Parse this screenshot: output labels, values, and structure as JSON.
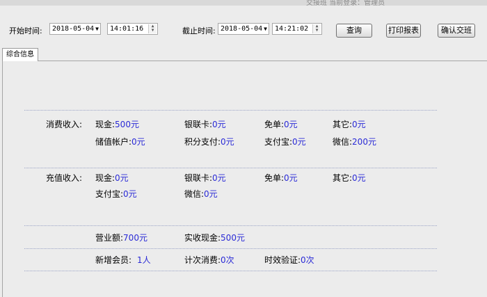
{
  "titlebar": {
    "text": "交接班   当前登录：管理员"
  },
  "toolbar": {
    "start_label": "开始时间:",
    "start_date": "2018-05-04",
    "start_time": "14:01:16",
    "end_label": "截止时间:",
    "end_date": "2018-05-04",
    "end_time": "14:21:02",
    "query_button": "查询",
    "print_button": "打印报表",
    "confirm_button": "确认交班"
  },
  "tab": {
    "label": "综合信息"
  },
  "consumption": {
    "label": "消费收入:",
    "cash_key": "现金:",
    "cash_val": "500元",
    "unionpay_key": "银联卡:",
    "unionpay_val": "0元",
    "free_key": "免单:",
    "free_val": "0元",
    "other_key": "其它:",
    "other_val": "0元",
    "stored_key": "储值帐户:",
    "stored_val": "0元",
    "points_key": "积分支付:",
    "points_val": "0元",
    "alipay_key": "支付宝:",
    "alipay_val": "0元",
    "wechat_key": "微信:",
    "wechat_val": "200元"
  },
  "recharge": {
    "label": "充值收入:",
    "cash_key": "现金:",
    "cash_val": "0元",
    "unionpay_key": "银联卡:",
    "unionpay_val": "0元",
    "free_key": "免单:",
    "free_val": "0元",
    "other_key": "其它:",
    "other_val": "0元",
    "alipay_key": "支付宝:",
    "alipay_val": "0元",
    "wechat_key": "微信:",
    "wechat_val": "0元"
  },
  "summary": {
    "turnover_key": "营业额:",
    "turnover_val": "700元",
    "actual_cash_key": "实收现金:",
    "actual_cash_val": "500元",
    "new_members_key": "新增会员:",
    "new_members_val": "1人",
    "count_consume_key": "计次消费:",
    "count_consume_val": "0次",
    "timed_verify_key": "时效验证:",
    "timed_verify_val": "0次"
  }
}
